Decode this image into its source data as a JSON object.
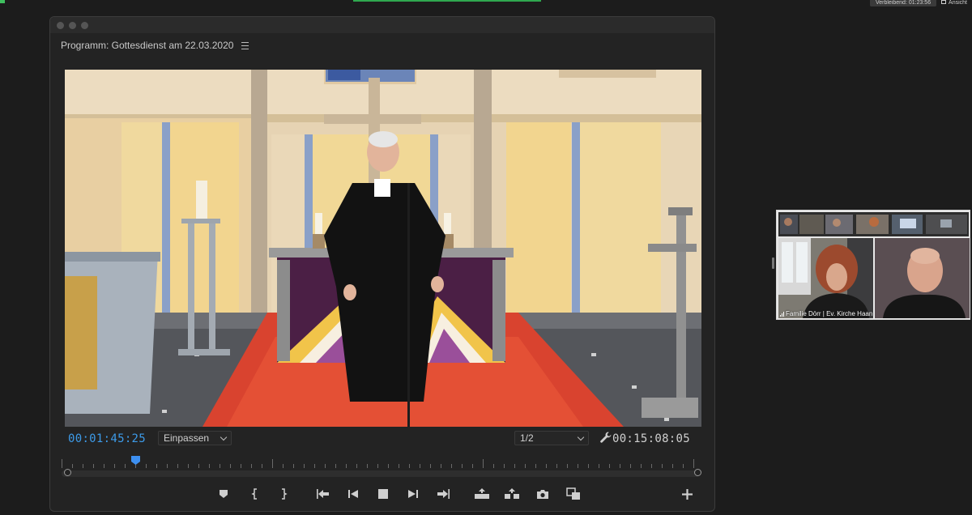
{
  "window": {
    "title": "Programm: Gottesdienst am 22.03.2020"
  },
  "zoom": {
    "timer_text": "Verbleibend: 01:23:56",
    "view_label": "Ansicht"
  },
  "monitor": {
    "current_timecode": "00:01:45:25",
    "zoom_select": "Einpassen",
    "resolution_select": "1/2",
    "duration_timecode": "00:15:08:05",
    "playhead_fraction": 0.116
  },
  "gallery": {
    "tile_label": "Familie Dörr | Ev. Kirche Haan"
  },
  "icons": {
    "marker": "add-marker-icon",
    "in": "mark-in-icon",
    "out": "mark-out-icon",
    "go_in": "go-to-in-icon",
    "step_back": "step-back-icon",
    "stop": "stop-icon",
    "step_forward": "step-forward-icon",
    "go_out": "go-to-out-icon",
    "lift": "lift-icon",
    "extract": "extract-icon",
    "export_frame": "camera-icon",
    "compare": "comparison-view-icon",
    "add": "plus-icon",
    "settings": "wrench-icon"
  },
  "colors": {
    "timecode_blue": "#3d9be9",
    "background": "#1c1c1c",
    "panel": "#232323"
  }
}
